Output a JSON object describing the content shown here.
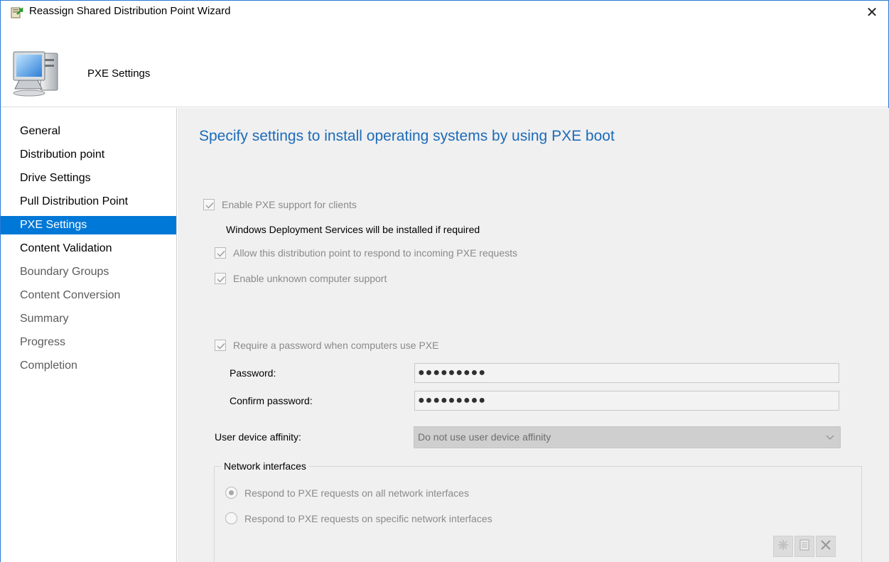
{
  "window": {
    "title": "Reassign Shared Distribution Point Wizard",
    "close_glyph": "✕"
  },
  "header": {
    "page_title": "PXE Settings",
    "icon": "computer-icon"
  },
  "nav": {
    "items": [
      {
        "label": "General",
        "state": "enabled"
      },
      {
        "label": "Distribution point",
        "state": "enabled"
      },
      {
        "label": "Drive Settings",
        "state": "enabled"
      },
      {
        "label": "Pull Distribution Point",
        "state": "enabled"
      },
      {
        "label": "PXE Settings",
        "state": "selected"
      },
      {
        "label": "Content Validation",
        "state": "enabled"
      },
      {
        "label": "Boundary Groups",
        "state": "disabled"
      },
      {
        "label": "Content Conversion",
        "state": "disabled"
      },
      {
        "label": "Summary",
        "state": "disabled"
      },
      {
        "label": "Progress",
        "state": "disabled"
      },
      {
        "label": "Completion",
        "state": "disabled"
      }
    ]
  },
  "main": {
    "heading": "Specify settings to install operating systems by using PXE boot",
    "enable_pxe_label": "Enable PXE support for clients",
    "wds_note": "Windows Deployment Services will be installed if required",
    "allow_respond_label": "Allow this distribution point to respond to incoming PXE requests",
    "unknown_computer_label": "Enable unknown computer support",
    "require_password_label": "Require a password when computers use PXE",
    "password_label": "Password:",
    "password_value": "●●●●●●●●●",
    "confirm_password_label": "Confirm password:",
    "confirm_password_value": "●●●●●●●●●",
    "user_device_affinity_label": "User device affinity:",
    "user_device_affinity_value": "Do not use user device affinity",
    "network_interfaces": {
      "legend": "Network interfaces",
      "option_all": "Respond to PXE requests on all network interfaces",
      "option_specific": "Respond to PXE requests on specific network interfaces",
      "selected": "all",
      "toolbar_icons": [
        "new-icon",
        "properties-icon",
        "delete-icon"
      ]
    },
    "checkboxes_checked": true,
    "colors": {
      "accent": "#0078d7",
      "heading": "#1c6bb9",
      "content_bg": "#f0f0f0"
    }
  }
}
